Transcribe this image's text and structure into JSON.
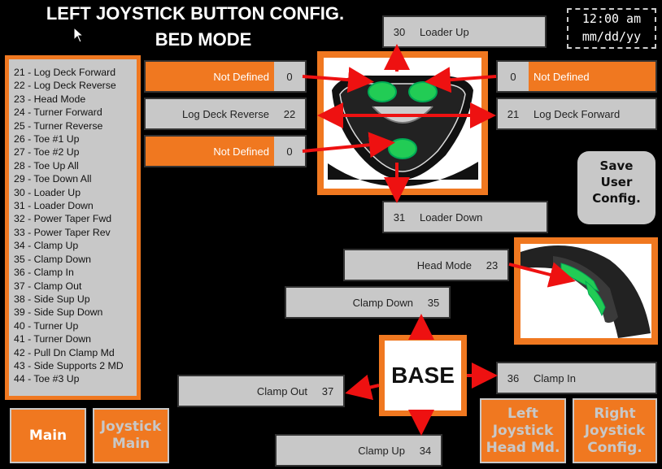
{
  "header": {
    "title_line1": "LEFT JOYSTICK BUTTON CONFIG.",
    "title_line2": "BED MODE",
    "time": "12:00 am",
    "date": "mm/dd/yy"
  },
  "legend": [
    "21 - Log Deck Forward",
    "22 - Log Deck Reverse",
    "23 - Head Mode",
    "24 - Turner Forward",
    "25 - Turner Reverse",
    "26 - Toe #1 Up",
    "27 - Toe #2 Up",
    "28 - Toe Up All",
    "29 - Toe Down All",
    "30 - Loader Up",
    "31 - Loader Down",
    "32 - Power Taper Fwd",
    "33 - Power Taper Rev",
    "34 - Clamp Up",
    "35 - Clamp Down",
    "36 - Clamp In",
    "37 - Clamp Out",
    "38 - Side Sup Up",
    "39 - Side Sup Down",
    "40 - Turner Up",
    "41 - Turner Down",
    "42 - Pull Dn Clamp Md",
    "43 - Side Supports 2 MD",
    "44 - Toe #3 Up"
  ],
  "fields": {
    "top": {
      "label": "Loader Up",
      "num": "30"
    },
    "left_btn": {
      "label": "Not Defined",
      "num": "0"
    },
    "right_btn": {
      "label": "Not Defined",
      "num": "0"
    },
    "left": {
      "label": "Log Deck Reverse",
      "num": "22"
    },
    "right": {
      "label": "Log Deck Forward",
      "num": "21"
    },
    "center_btn": {
      "label": "Not Defined",
      "num": "0"
    },
    "bottom": {
      "label": "Loader Down",
      "num": "31"
    },
    "head": {
      "label": "Head Mode",
      "num": "23"
    },
    "base_up": {
      "label": "Clamp Down",
      "num": "35"
    },
    "base_left": {
      "label": "Clamp Out",
      "num": "37"
    },
    "base_right": {
      "label": "Clamp In",
      "num": "36"
    },
    "base_down": {
      "label": "Clamp Up",
      "num": "34"
    }
  },
  "base_label": "BASE",
  "save": {
    "line1": "Save",
    "line2": "User",
    "line3": "Config."
  },
  "buttons": {
    "main": "Main",
    "joystick_main_1": "Joystick",
    "joystick_main_2": "Main",
    "left_head_1": "Left",
    "left_head_2": "Joystick",
    "left_head_3": "Head Md.",
    "right_config_1": "Right",
    "right_config_2": "Joystick",
    "right_config_3": "Config."
  },
  "colors": {
    "accent": "#f07820",
    "panel": "#c8c8c8",
    "arrow": "#ee1111",
    "button_green": "#22cc55"
  }
}
